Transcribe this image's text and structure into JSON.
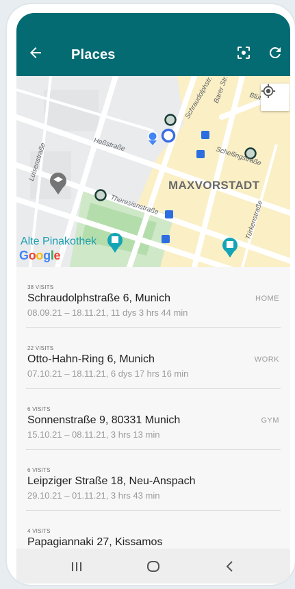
{
  "header": {
    "title": "Places",
    "back_icon": "arrow-left-icon",
    "focus_icon": "center-focus-icon",
    "refresh_icon": "refresh-icon",
    "bg_color": "#046b72"
  },
  "map": {
    "district_label": "MAXVORSTADT",
    "poi_label": "Alte Pinakothek",
    "attribution": "Google",
    "streets": [
      "Schraudolphstr.",
      "Barer Str.",
      "Blütenstr.",
      "Heßstraße",
      "Schellingstraße",
      "Luisenstraße",
      "Theresienstraße",
      "Türkenstraße"
    ],
    "my_location_icon": "my-location-icon"
  },
  "places": [
    {
      "visits": "38 VISITS",
      "address": "Schraudolphstraße 6, Munich",
      "dates": "08.09.21 – 18.11.21, 11 dys 3 hrs 44 min",
      "tag": "HOME"
    },
    {
      "visits": "22 VISITS",
      "address": "Otto-Hahn-Ring 6, Munich",
      "dates": "07.10.21 – 18.11.21, 6 dys 17 hrs 16 min",
      "tag": "WORK"
    },
    {
      "visits": "6 VISITS",
      "address": "Sonnenstraße 9, 80331 Munich",
      "dates": "15.10.21 – 08.11.21, 3 hrs 13 min",
      "tag": "GYM"
    },
    {
      "visits": "6 VISITS",
      "address": "Leipziger Straße 18, Neu-Anspach",
      "dates": "29.10.21 – 01.11.21, 3 hrs 43 min",
      "tag": ""
    },
    {
      "visits": "4 VISITS",
      "address": "Papagiannaki 27, Kissamos",
      "dates": "",
      "tag": ""
    }
  ],
  "navbar": {
    "recents_icon": "recent-apps-icon",
    "home_icon": "home-circle-icon",
    "back_icon": "chevron-left-icon"
  }
}
